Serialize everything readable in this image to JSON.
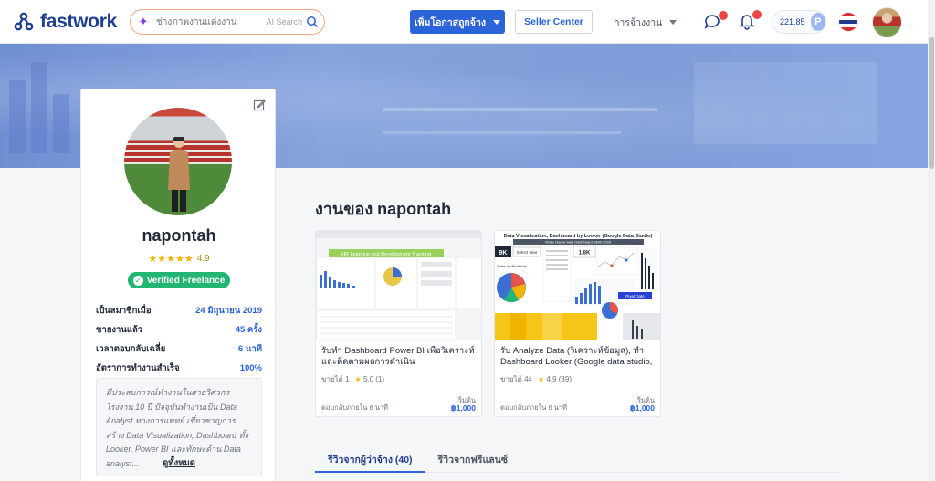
{
  "header": {
    "logo_text": "fastwork",
    "search_placeholder": "ช่างภาพงานแต่งงาน",
    "search_ai_label": "AI Search",
    "post_job_label": "เพิ่มโอกาสถูกจ้าง",
    "seller_center_label": "Seller Center",
    "hire_menu_label": "การจ้างงาน",
    "points": "221.85",
    "points_badge": "P"
  },
  "profile": {
    "name": "napontah",
    "rating": "4.9",
    "verified_label": "Verified Freelance",
    "stats": [
      {
        "label": "เป็นสมาชิกเมื่อ",
        "value": "24 มิถุนายน 2019"
      },
      {
        "label": "ขายงานแล้ว",
        "value": "45 ครั้ง"
      },
      {
        "label": "เวลาตอบกลับเฉลี่ย",
        "value": "6 นาที"
      },
      {
        "label": "อัตราการทำงานสำเร็จ",
        "value": "100%"
      }
    ],
    "bio": "มีประสบการณ์ทำงานในสายวิศวกรโรงงาน 10 ปี ปัจจุบันทำงานเป็น Data Analyst ทางการแพทย์ เชี่ยวชาญการสร้าง Data Visualization, Dashboard ทั้ง Looker, Power BI และทักษะด้าน Data analyst...",
    "bio_more_label": "ดูทั้งหมด"
  },
  "main": {
    "section_title": "งานของ napontah",
    "jobs": [
      {
        "thumb_title": "HR Learning and Development Tracking",
        "title": "รับทำ Dashboard Power BI เพื่อวิเคราะห์และติดตามผลการดำเนิน",
        "sold": "ขายได้ 1",
        "rating": "5.0 (1)",
        "response": "ตอบกลับภายใน 6 นาที",
        "price_label": "เริ่มต้น",
        "price": "฿1,000"
      },
      {
        "thumb_title": "Data Visualization, Dashboard by Looker (Google Data Studio)",
        "thumb_sub": "Video Game Sale Dashboard 1980-2020",
        "thumb_kpi": "9K",
        "thumb_kpi2": "1.8K",
        "thumb_select": "Select Year",
        "thumb_pub_label": "Sales by Publisher",
        "thumb_pixel": "Pixel Date",
        "title": "รับ Analyze Data (วิเคราะห์ข้อมูล), ทำ Dashboard Looker (Google data studio,",
        "sold": "ขายได้ 44",
        "rating": "4.9 (39)",
        "response": "ตอบกลับภายใน 6 นาที",
        "price_label": "เริ่มต้น",
        "price": "฿1,000"
      }
    ],
    "tabs": [
      {
        "label": "รีวิวจากผู้ว่าจ้าง (40)"
      },
      {
        "label": "รีวิวจากฟรีแลนซ์"
      }
    ]
  },
  "colors": {
    "brand": "#1f3f8f",
    "primary": "#2b63d9",
    "verified": "#22b573",
    "star": "#f5b301"
  }
}
